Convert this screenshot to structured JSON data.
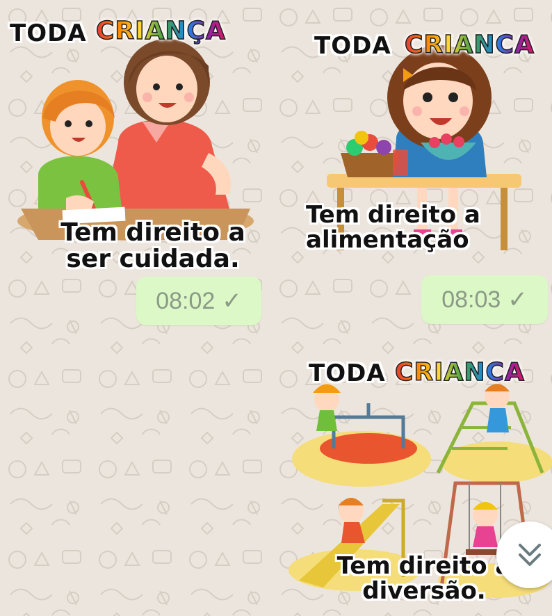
{
  "background_color": "#ece5dd",
  "bubble_color": "#dcf8c6",
  "messages": [
    {
      "header_word1": "TODA",
      "header_word2": "CRIANÇA",
      "caption_line1": "Tem direito a",
      "caption_line2": "ser cuidada.",
      "time": "08:02",
      "status_icon": "check-icon"
    },
    {
      "header_word1": "TODA",
      "header_word2": "CRIANCA",
      "caption_line1": "Tem direito a",
      "caption_line2": "alimentação",
      "time": "08:03",
      "status_icon": "check-icon"
    },
    {
      "header_word1": "TODA",
      "header_word2": "CRIANCA",
      "caption_line1": "Tem direito a",
      "caption_line2": "diversão."
    }
  ],
  "check_glyph": "✓",
  "scroll_button": {
    "icon": "double-chevron-down-icon"
  }
}
